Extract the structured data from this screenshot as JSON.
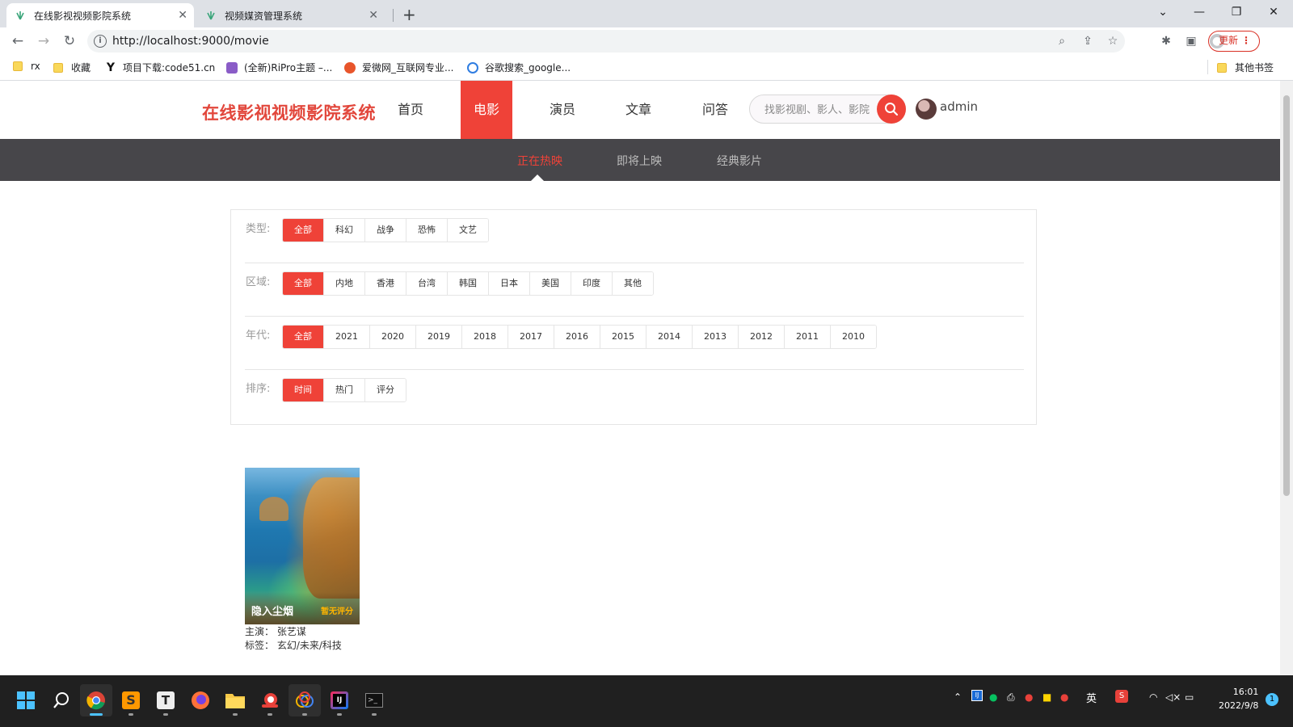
{
  "browser": {
    "tabs": [
      {
        "title": "在线影视视频影院系统",
        "active": true
      },
      {
        "title": "视频媒资管理系统",
        "active": false
      }
    ],
    "url": "http://localhost:9000/movie",
    "update_label": "更新",
    "bookmarks": [
      {
        "label": "rx",
        "icon": "folder-icon"
      },
      {
        "label": "收藏",
        "icon": "folder-icon"
      },
      {
        "label": "项目下载:code51.cn",
        "icon": "y-logo-icon"
      },
      {
        "label": "(全新)RiPro主题 –...",
        "icon": "ripro-icon"
      },
      {
        "label": "爱微网_互联网专业...",
        "icon": "aiwei-icon"
      },
      {
        "label": "谷歌搜索_google...",
        "icon": "360-icon"
      }
    ],
    "other_bookmarks": "其他书签"
  },
  "site": {
    "logo": "在线影视视频影院系统",
    "nav": [
      {
        "label": "首页",
        "active": false
      },
      {
        "label": "电影",
        "active": true
      },
      {
        "label": "演员",
        "active": false
      },
      {
        "label": "文章",
        "active": false
      },
      {
        "label": "问答",
        "active": false
      }
    ],
    "search_placeholder": "找影视剧、影人、影院",
    "username": "admin",
    "accent_color": "#ef4238",
    "subnav": [
      {
        "label": "正在热映",
        "active": true
      },
      {
        "label": "即将上映",
        "active": false
      },
      {
        "label": "经典影片",
        "active": false
      }
    ]
  },
  "filters": [
    {
      "label": "类型:",
      "options": [
        "全部",
        "科幻",
        "战争",
        "恐怖",
        "文艺"
      ],
      "selected": 0
    },
    {
      "label": "区域:",
      "options": [
        "全部",
        "内地",
        "香港",
        "台湾",
        "韩国",
        "日本",
        "美国",
        "印度",
        "其他"
      ],
      "selected": 0
    },
    {
      "label": "年代:",
      "options": [
        "全部",
        "2021",
        "2020",
        "2019",
        "2018",
        "2017",
        "2016",
        "2015",
        "2014",
        "2013",
        "2012",
        "2011",
        "2010"
      ],
      "selected": 0
    },
    {
      "label": "排序:",
      "options": [
        "时间",
        "热门",
        "评分"
      ],
      "selected": 0
    }
  ],
  "movies": [
    {
      "title": "隐入尘烟",
      "score": "暂无评分",
      "starring": "主演： 张艺谋",
      "tags": "标签： 玄幻/未来/科技"
    }
  ],
  "taskbar": {
    "time": "16:01",
    "date": "2022/9/8",
    "ime": "英",
    "notifications": "1"
  }
}
